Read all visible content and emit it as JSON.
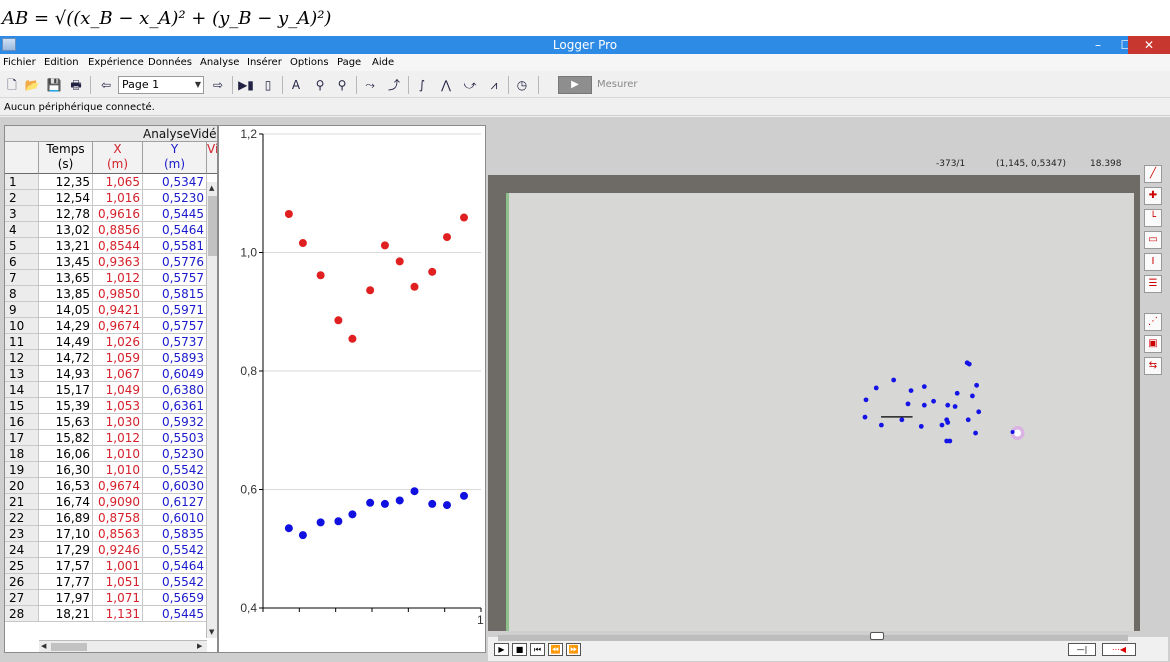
{
  "formula": "AB = √((x_B − x_A)² + (y_B − y_A)²)",
  "window": {
    "title": "Logger Pro",
    "minimize": "–",
    "maximize": "☐",
    "close": "✕"
  },
  "menu": [
    "Fichier",
    "Edition",
    "Expérience",
    "Données",
    "Analyse",
    "Insérer",
    "Options",
    "Page",
    "Aide"
  ],
  "toolbar": {
    "page_value": "Page 1",
    "measure_label": "Mesurer"
  },
  "status": "Aucun périphérique connecté.",
  "table": {
    "dataset": "AnalyseVidéo",
    "columns": [
      {
        "name": "Temps",
        "unit": "(s)"
      },
      {
        "name": "X",
        "unit": "(m)"
      },
      {
        "name": "Y",
        "unit": "(m)"
      },
      {
        "name": "Vi",
        "unit": ""
      }
    ],
    "rows": [
      [
        "1",
        "12,35",
        "1,065",
        "0,5347"
      ],
      [
        "2",
        "12,54",
        "1,016",
        "0,5230"
      ],
      [
        "3",
        "12,78",
        "0,9616",
        "0,5445"
      ],
      [
        "4",
        "13,02",
        "0,8856",
        "0,5464"
      ],
      [
        "5",
        "13,21",
        "0,8544",
        "0,5581"
      ],
      [
        "6",
        "13,45",
        "0,9363",
        "0,5776"
      ],
      [
        "7",
        "13,65",
        "1,012",
        "0,5757"
      ],
      [
        "8",
        "13,85",
        "0,9850",
        "0,5815"
      ],
      [
        "9",
        "14,05",
        "0,9421",
        "0,5971"
      ],
      [
        "10",
        "14,29",
        "0,9674",
        "0,5757"
      ],
      [
        "11",
        "14,49",
        "1,026",
        "0,5737"
      ],
      [
        "12",
        "14,72",
        "1,059",
        "0,5893"
      ],
      [
        "13",
        "14,93",
        "1,067",
        "0,6049"
      ],
      [
        "14",
        "15,17",
        "1,049",
        "0,6380"
      ],
      [
        "15",
        "15,39",
        "1,053",
        "0,6361"
      ],
      [
        "16",
        "15,63",
        "1,030",
        "0,5932"
      ],
      [
        "17",
        "15,82",
        "1,012",
        "0,5503"
      ],
      [
        "18",
        "16,06",
        "1,010",
        "0,5230"
      ],
      [
        "19",
        "16,30",
        "1,010",
        "0,5542"
      ],
      [
        "20",
        "16,53",
        "0,9674",
        "0,6030"
      ],
      [
        "21",
        "16,74",
        "0,9090",
        "0,6127"
      ],
      [
        "22",
        "16,89",
        "0,8758",
        "0,6010"
      ],
      [
        "23",
        "17,10",
        "0,8563",
        "0,5835"
      ],
      [
        "24",
        "17,29",
        "0,9246",
        "0,5542"
      ],
      [
        "25",
        "17,57",
        "1,001",
        "0,5464"
      ],
      [
        "26",
        "17,77",
        "1,051",
        "0,5542"
      ],
      [
        "27",
        "17,97",
        "1,071",
        "0,5659"
      ],
      [
        "28",
        "18,21",
        "1,131",
        "0,5445"
      ]
    ]
  },
  "chart_data": {
    "type": "scatter",
    "ylim": [
      0.4,
      1.2
    ],
    "yticks": [
      "0,4",
      "0,6",
      "0,8",
      "1,0",
      "1,2"
    ],
    "x_partial_tick": "1",
    "series": [
      {
        "color": "#e02020",
        "x": [
          12.35,
          12.54,
          12.78,
          13.02,
          13.21,
          13.45,
          13.65,
          13.85,
          14.05,
          14.29,
          14.49,
          14.72
        ],
        "y": [
          1.065,
          1.016,
          0.9616,
          0.8856,
          0.8544,
          0.9363,
          1.012,
          0.985,
          0.9421,
          0.9674,
          1.026,
          1.059
        ]
      },
      {
        "color": "#1010e0",
        "x": [
          12.35,
          12.54,
          12.78,
          13.02,
          13.21,
          13.45,
          13.65,
          13.85,
          14.05,
          14.29,
          14.49,
          14.72
        ],
        "y": [
          0.5347,
          0.523,
          0.5445,
          0.5464,
          0.5581,
          0.5776,
          0.5757,
          0.5815,
          0.5971,
          0.5757,
          0.5737,
          0.5893
        ]
      }
    ]
  },
  "video": {
    "frame_readout": "-373/1",
    "coord_readout": "(1,145, 0,5347)",
    "time_readout": "18.398",
    "points": [
      [
        1.065,
        0.5347
      ],
      [
        1.016,
        0.523
      ],
      [
        0.9616,
        0.5445
      ],
      [
        0.8856,
        0.5464
      ],
      [
        0.8544,
        0.5581
      ],
      [
        0.9363,
        0.5776
      ],
      [
        1.012,
        0.5757
      ],
      [
        0.985,
        0.5815
      ],
      [
        0.9421,
        0.5971
      ],
      [
        0.9674,
        0.5757
      ],
      [
        1.026,
        0.5737
      ],
      [
        1.059,
        0.5893
      ],
      [
        1.067,
        0.6049
      ],
      [
        1.049,
        0.638
      ],
      [
        1.053,
        0.6361
      ],
      [
        1.03,
        0.5932
      ],
      [
        1.012,
        0.5503
      ],
      [
        1.01,
        0.523
      ],
      [
        1.01,
        0.5542
      ],
      [
        0.9674,
        0.603
      ],
      [
        0.909,
        0.6127
      ],
      [
        0.8758,
        0.601
      ],
      [
        0.8563,
        0.5835
      ],
      [
        0.9246,
        0.5542
      ],
      [
        1.001,
        0.5464
      ],
      [
        1.051,
        0.5542
      ],
      [
        1.071,
        0.5659
      ]
    ],
    "current_point": [
      1.145,
      0.5347
    ],
    "point_color": "#1414e6",
    "glow_color": "#e070ff"
  },
  "icons": [
    "new-file-icon",
    "open-folder-icon",
    "save-icon",
    "print-icon",
    "prev-page-icon",
    "next-page-icon",
    "data-browser-icon",
    "sensor-icon",
    "autoscale-icon",
    "zoom-in-icon",
    "zoom-out-icon",
    "examine-icon",
    "tangent-icon",
    "integral-icon",
    "statistics-icon",
    "curve-fit-icon",
    "linear-fit-icon",
    "fft-icon",
    "timer-icon"
  ]
}
